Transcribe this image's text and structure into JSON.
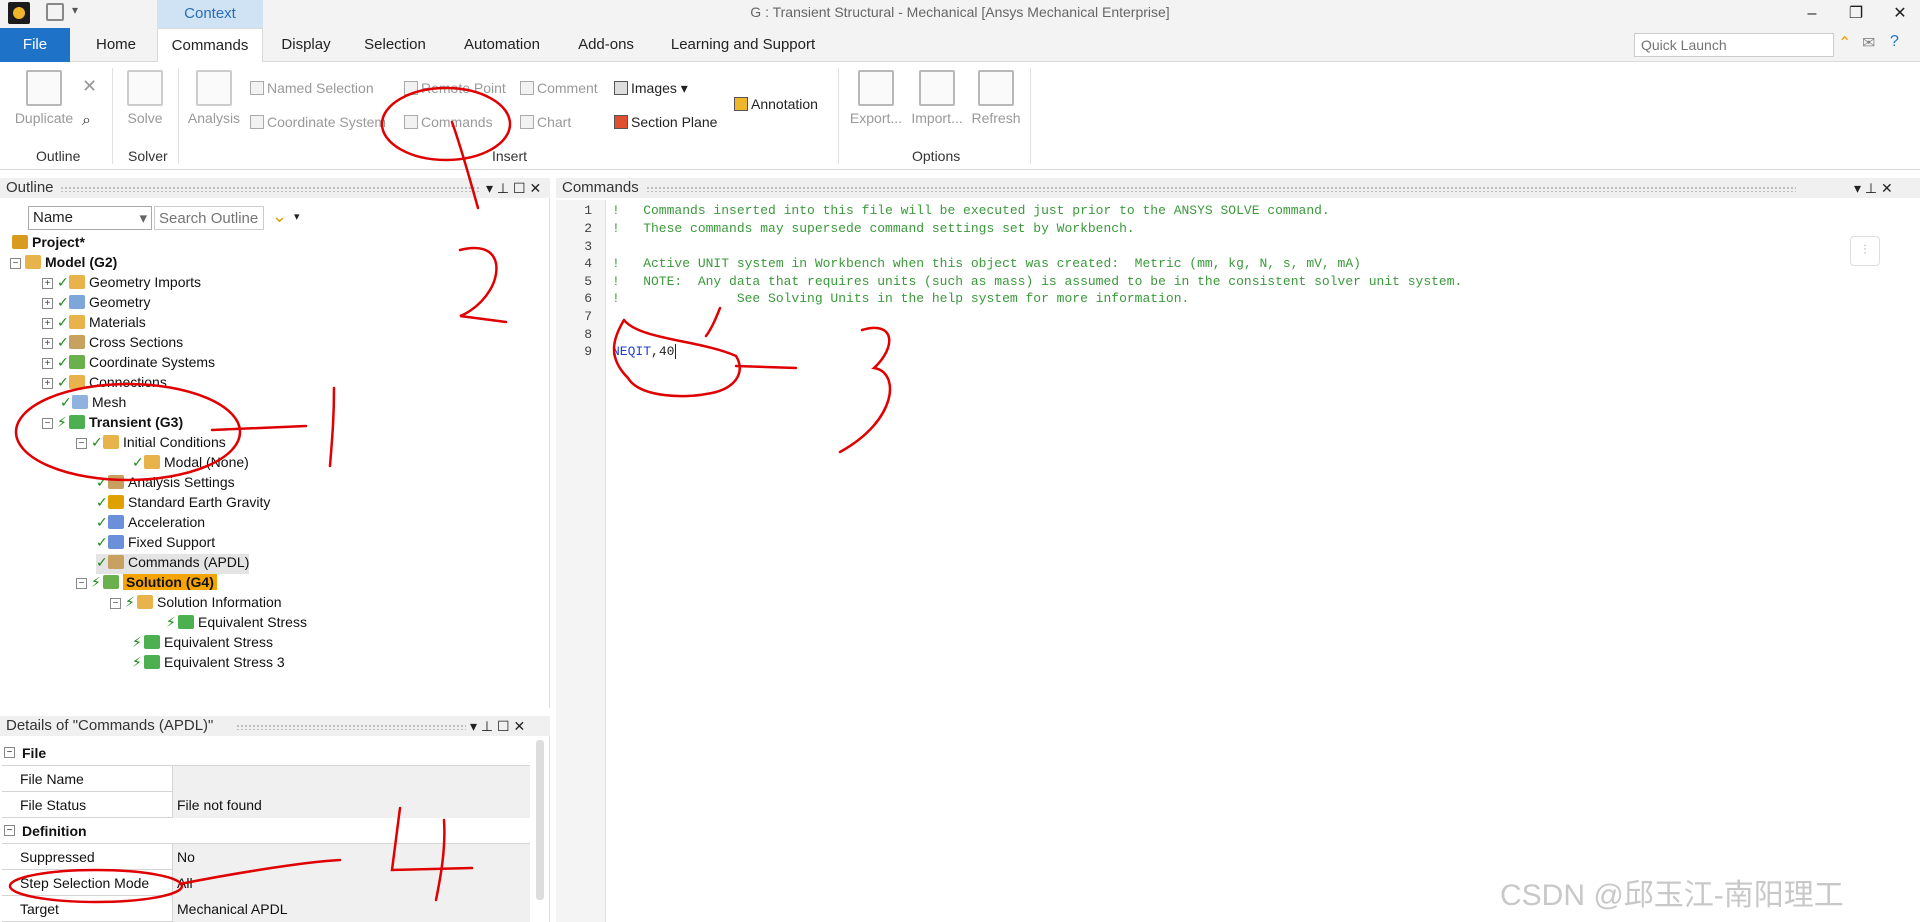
{
  "titlebar": {
    "context_label": "Context",
    "window_title": "G : Transient Structural - Mechanical [Ansys Mechanical Enterprise]",
    "minimize": "–",
    "restore": "❐",
    "close": "✕"
  },
  "tabs": {
    "file": "File",
    "home": "Home",
    "commands": "Commands",
    "display": "Display",
    "selection": "Selection",
    "automation": "Automation",
    "addons": "Add-ons",
    "learning": "Learning and Support",
    "quick_launch_placeholder": "Quick Launch"
  },
  "ribbon": {
    "duplicate": "Duplicate",
    "outline_group": "Outline",
    "solve": "Solve",
    "solver_group": "Solver",
    "analysis": "Analysis",
    "named_selection": "Named Selection",
    "remote_point": "Remote Point",
    "comment": "Comment",
    "images": "Images",
    "annotation": "Annotation",
    "coordinate_system": "Coordinate System",
    "commands": "Commands",
    "chart": "Chart",
    "section_plane": "Section Plane",
    "insert_group": "Insert",
    "export": "Export...",
    "import": "Import...",
    "refresh": "Refresh",
    "options_group": "Options"
  },
  "outline": {
    "title": "Outline",
    "name_select": "Name",
    "search_placeholder": "Search Outline",
    "tree": {
      "project": "Project*",
      "model": "Model (G2)",
      "geometry_imports": "Geometry Imports",
      "geometry": "Geometry",
      "materials": "Materials",
      "cross_sections": "Cross Sections",
      "coordinate_systems": "Coordinate Systems",
      "connections": "Connections",
      "mesh": "Mesh",
      "transient": "Transient (G3)",
      "initial_conditions": "Initial Conditions",
      "modal": "Modal (None)",
      "analysis_settings": "Analysis Settings",
      "earth_gravity": "Standard Earth Gravity",
      "acceleration": "Acceleration",
      "fixed_support": "Fixed Support",
      "commands_apdl": "Commands (APDL)",
      "solution": "Solution (G4)",
      "solution_information": "Solution Information",
      "equivalent_stress_child": "Equivalent Stress",
      "equivalent_stress": "Equivalent Stress",
      "equivalent_stress_3": "Equivalent Stress 3"
    }
  },
  "details": {
    "title": "Details of \"Commands (APDL)\"",
    "rows": [
      {
        "key": "File",
        "value": ""
      },
      {
        "key": "File Name",
        "value": ""
      },
      {
        "key": "File Status",
        "value": "File not found"
      },
      {
        "key": "Definition",
        "value": ""
      },
      {
        "key": "Suppressed",
        "value": "No"
      },
      {
        "key": "Step Selection Mode",
        "value": "All"
      },
      {
        "key": "Target",
        "value": "Mechanical APDL"
      }
    ]
  },
  "commands_panel": {
    "title": "Commands",
    "line_numbers": [
      "1",
      "2",
      "3",
      "4",
      "5",
      "6",
      "7",
      "8",
      "9"
    ],
    "lines": [
      "!   Commands inserted into this file will be executed just prior to the ANSYS SOLVE command.",
      "!   These commands may supersede command settings set by Workbench.",
      "",
      "!   Active UNIT system in Workbench when this object was created:  Metric (mm, kg, N, s, mV, mA)",
      "!   NOTE:  Any data that requires units (such as mass) is assumed to be in the consistent solver unit system.",
      "!               See Solving Units in the help system for more information.",
      "",
      ""
    ],
    "command_name": "NEQIT",
    "command_args": ",40"
  },
  "annotations": [
    "1",
    "2",
    "3",
    "4"
  ],
  "watermark": "CSDN @邱玉江-南阳理工",
  "colors": {
    "file_tab": "#1e73c8",
    "solution_highlight": "#f6a400",
    "comment_green": "#3a9a3a",
    "command_blue": "#1f3fcf",
    "annotation_red": "#e00000"
  }
}
